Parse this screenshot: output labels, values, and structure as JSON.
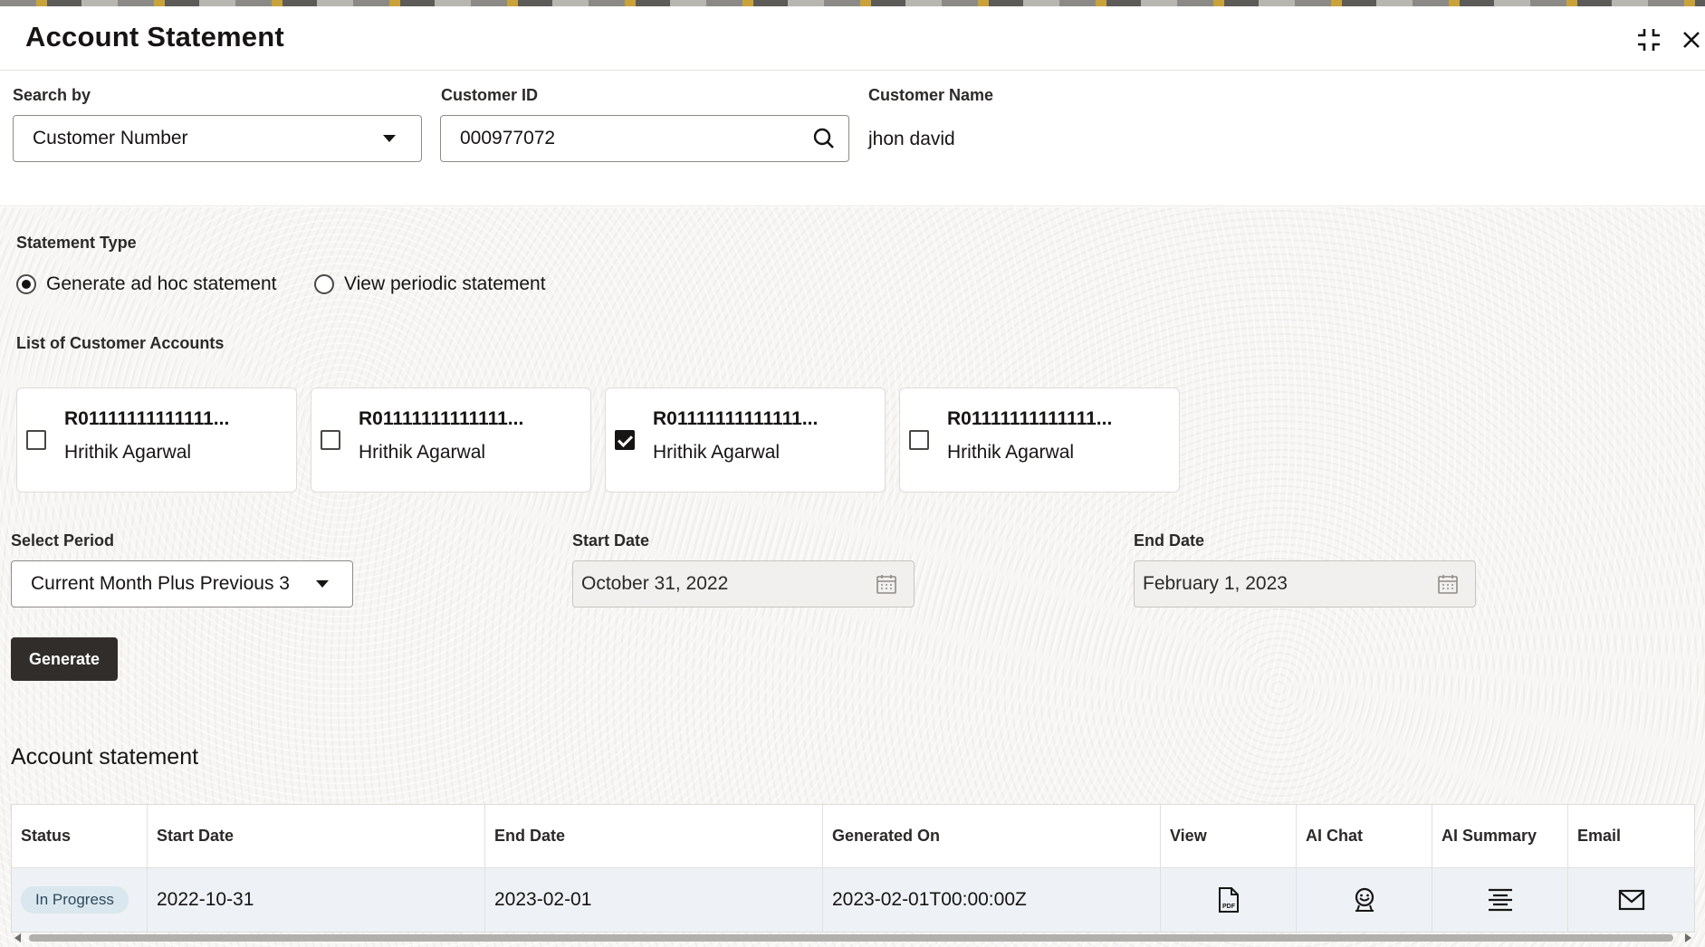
{
  "window": {
    "title": "Account Statement",
    "collapse_icon": "collapse-icon",
    "close_icon": "close-icon"
  },
  "search": {
    "search_by_label": "Search by",
    "search_by_value": "Customer Number",
    "customer_id_label": "Customer ID",
    "customer_id_value": "000977072",
    "customer_name_label": "Customer Name",
    "customer_name_value": "jhon david"
  },
  "statement_type": {
    "label": "Statement Type",
    "options": [
      {
        "label": "Generate ad hoc statement",
        "selected": true
      },
      {
        "label": "View periodic statement",
        "selected": false
      }
    ]
  },
  "accounts": {
    "label": "List of Customer Accounts",
    "items": [
      {
        "number": "R01111111111111...",
        "name": "Hrithik Agarwal",
        "checked": false
      },
      {
        "number": "R01111111111111...",
        "name": "Hrithik Agarwal",
        "checked": false
      },
      {
        "number": "R01111111111111...",
        "name": "Hrithik Agarwal",
        "checked": true
      },
      {
        "number": "R01111111111111...",
        "name": "Hrithik Agarwal",
        "checked": false
      }
    ]
  },
  "period": {
    "select_label": "Select Period",
    "select_value": "Current Month Plus Previous 3",
    "start_label": "Start Date",
    "start_value": "October 31, 2022",
    "end_label": "End Date",
    "end_value": "February 1, 2023"
  },
  "actions": {
    "generate_label": "Generate"
  },
  "statement_table": {
    "title": "Account statement",
    "columns": [
      "Status",
      "Start Date",
      "End Date",
      "Generated On",
      "View",
      "AI Chat",
      "AI Summary",
      "Email"
    ],
    "rows": [
      {
        "status": "In Progress",
        "start_date": "2022-10-31",
        "end_date": "2023-02-01",
        "generated_on": "2023-02-01T00:00:00Z",
        "view_icon": "pdf-icon",
        "ai_chat_icon": "ai-chat-icon",
        "ai_summary_icon": "ai-summary-icon",
        "email_icon": "email-icon"
      }
    ]
  },
  "colors": {
    "primary_button": "#312d2a",
    "badge_bg": "#dbe7ee",
    "row_bg": "#eef2f6"
  }
}
